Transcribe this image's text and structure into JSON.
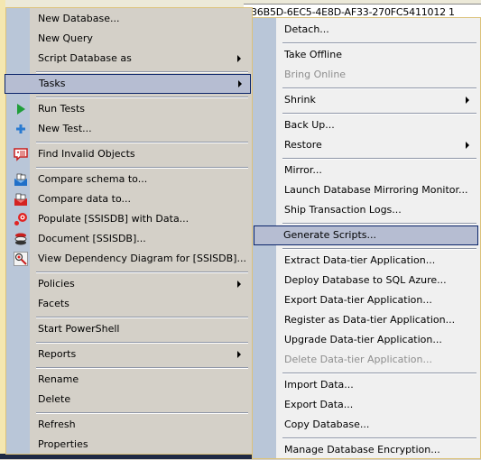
{
  "background": {
    "grid_guid": "36B5D-6EC5-4E8D-AF33-270FC5411012",
    "grid_value": "1"
  },
  "context_menu": {
    "items": [
      {
        "label": "New Database...",
        "icon": null,
        "submenu": false
      },
      {
        "label": "New Query",
        "icon": null,
        "submenu": false
      },
      {
        "label": "Script Database as",
        "icon": null,
        "submenu": true
      },
      {
        "label": "Tasks",
        "icon": null,
        "submenu": true,
        "selected": true
      },
      {
        "label": "Run Tests",
        "icon": "play-icon",
        "submenu": false
      },
      {
        "label": "New Test...",
        "icon": "plus-icon",
        "submenu": false
      },
      {
        "label": "Find Invalid Objects",
        "icon": "speech-bubble-icon",
        "submenu": false
      },
      {
        "label": "Compare schema to...",
        "icon": "compare-schema-icon",
        "submenu": false
      },
      {
        "label": "Compare data to...",
        "icon": "compare-data-icon",
        "submenu": false
      },
      {
        "label": "Populate [SSISDB] with Data...",
        "icon": "populate-icon",
        "submenu": false
      },
      {
        "label": "Document [SSISDB]...",
        "icon": "document-stack-icon",
        "submenu": false
      },
      {
        "label": "View Dependency Diagram for [SSISDB]...",
        "icon": "magnifier-icon",
        "submenu": false
      },
      {
        "label": "Policies",
        "icon": null,
        "submenu": true
      },
      {
        "label": "Facets",
        "icon": null,
        "submenu": false
      },
      {
        "label": "Start PowerShell",
        "icon": null,
        "submenu": false
      },
      {
        "label": "Reports",
        "icon": null,
        "submenu": true
      },
      {
        "label": "Rename",
        "icon": null,
        "submenu": false
      },
      {
        "label": "Delete",
        "icon": null,
        "submenu": false
      },
      {
        "label": "Refresh",
        "icon": null,
        "submenu": false
      },
      {
        "label": "Properties",
        "icon": null,
        "submenu": false
      }
    ]
  },
  "tasks_submenu": {
    "items": [
      {
        "label": "Detach...",
        "submenu": false,
        "disabled": false
      },
      {
        "label": "Take Offline",
        "submenu": false,
        "disabled": false
      },
      {
        "label": "Bring Online",
        "submenu": false,
        "disabled": true
      },
      {
        "label": "Shrink",
        "submenu": true,
        "disabled": false
      },
      {
        "label": "Back Up...",
        "submenu": false,
        "disabled": false
      },
      {
        "label": "Restore",
        "submenu": true,
        "disabled": false
      },
      {
        "label": "Mirror...",
        "submenu": false,
        "disabled": false
      },
      {
        "label": "Launch Database Mirroring Monitor...",
        "submenu": false,
        "disabled": false
      },
      {
        "label": "Ship Transaction Logs...",
        "submenu": false,
        "disabled": false
      },
      {
        "label": "Generate Scripts...",
        "submenu": false,
        "disabled": false,
        "selected": true
      },
      {
        "label": "Extract Data-tier Application...",
        "submenu": false,
        "disabled": false
      },
      {
        "label": "Deploy Database to SQL Azure...",
        "submenu": false,
        "disabled": false
      },
      {
        "label": "Export Data-tier Application...",
        "submenu": false,
        "disabled": false
      },
      {
        "label": "Register as Data-tier Application...",
        "submenu": false,
        "disabled": false
      },
      {
        "label": "Upgrade Data-tier Application...",
        "submenu": false,
        "disabled": false
      },
      {
        "label": "Delete Data-tier Application...",
        "submenu": false,
        "disabled": true
      },
      {
        "label": "Import Data...",
        "submenu": false,
        "disabled": false
      },
      {
        "label": "Export Data...",
        "submenu": false,
        "disabled": false
      },
      {
        "label": "Copy Database...",
        "submenu": false,
        "disabled": false
      },
      {
        "label": "Manage Database Encryption...",
        "submenu": false,
        "disabled": false
      }
    ]
  }
}
